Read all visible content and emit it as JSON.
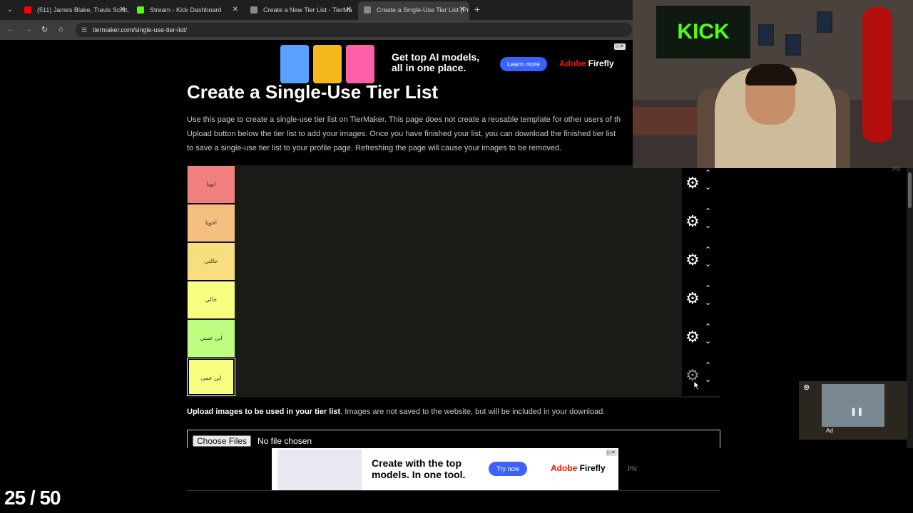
{
  "browser": {
    "tabs": [
      {
        "label": "(511) James Blake, Travis Scott,",
        "favicon_color": "#ff0000",
        "active": false
      },
      {
        "label": "Stream - Kick Dashboard",
        "favicon_color": "#53fc18",
        "active": false
      },
      {
        "label": "Create a New Tier List - TierMa",
        "favicon_color": "#888888",
        "active": false
      },
      {
        "label": "Create a Single-Use Tier List (Pr",
        "favicon_color": "#888888",
        "active": true
      }
    ],
    "url": "tiermaker.com/single-use-tier-list/"
  },
  "ad_top": {
    "headline": "Get top AI models, all in one place.",
    "button": "Learn more",
    "brand_prefix": "Adobe",
    "brand_suffix": " Firefly"
  },
  "page": {
    "title": "Create a Single-Use Tier List",
    "intro_lines": [
      "Use this page to create a single-use tier list on TierMaker. This page does not create a reusable template for other users of th",
      "Upload button below the tier list to add your images. Once you have finished your list, you can download the finished tier list",
      "to save a single-use tier list to your profile page. Refreshing the page will cause your images to be removed."
    ],
    "upload_bold": "Upload images to be used in your tier list",
    "upload_rest": ". Images are not saved to the website, but will be included in your download.",
    "choose_files": "Choose Files",
    "no_file": "No file chosen"
  },
  "tiers": [
    {
      "label": "ابويا",
      "color": "#f07f80"
    },
    {
      "label": "اخويا",
      "color": "#f5bf80"
    },
    {
      "label": "خالتي",
      "color": "#f7df7f"
    },
    {
      "label": "خالي",
      "color": "#f8fe7f"
    },
    {
      "label": "ابن عمتي",
      "color": "#bdfe80"
    },
    {
      "label": "ابن عمي",
      "color": "#f8fe7f"
    }
  ],
  "webcam": {
    "poster_text": "KICK"
  },
  "watermark": "PN",
  "mini_player": {
    "ad_label": "Ad"
  },
  "ad_bottom": {
    "headline": "Create with the top models. In one tool.",
    "button": "Try now",
    "brand_prefix": "Adobe",
    "brand_suffix": " Firefly"
  },
  "counter": "25 / 50"
}
